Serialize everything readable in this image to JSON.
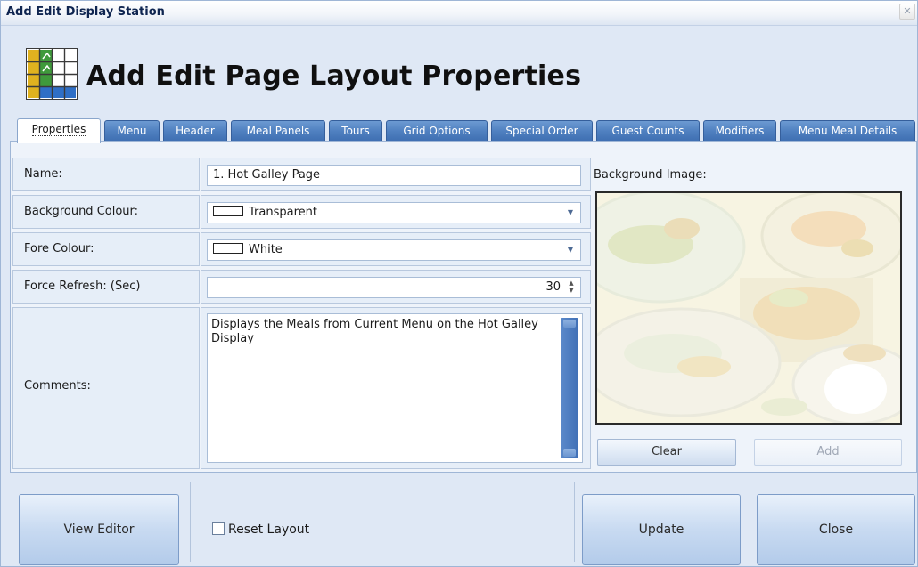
{
  "window": {
    "title": "Add Edit Display Station",
    "close_glyph": "✕"
  },
  "header": {
    "title": "Add Edit Page Layout Properties",
    "logo_icon": "grid-table-icon"
  },
  "tabs": [
    {
      "label": "Properties",
      "active": true
    },
    {
      "label": "Menu",
      "active": false
    },
    {
      "label": "Header",
      "active": false
    },
    {
      "label": "Meal Panels",
      "active": false
    },
    {
      "label": "Tours",
      "active": false
    },
    {
      "label": "Grid Options",
      "active": false
    },
    {
      "label": "Special Order",
      "active": false
    },
    {
      "label": "Guest Counts",
      "active": false
    },
    {
      "label": "Modifiers",
      "active": false
    },
    {
      "label": "Menu Meal Details",
      "active": false
    }
  ],
  "form": {
    "name": {
      "label": "Name:",
      "value": "1. Hot Galley Page"
    },
    "background_colour": {
      "label": "Background Colour:",
      "value": "Transparent"
    },
    "fore_colour": {
      "label": "Fore Colour:",
      "value": "White"
    },
    "force_refresh": {
      "label": "Force Refresh: (Sec)",
      "value": "30"
    },
    "comments": {
      "label": "Comments:",
      "value": "Displays the Meals from Current Menu on the Hot Galley Display"
    }
  },
  "background_image": {
    "label": "Background Image:",
    "clear_label": "Clear",
    "add_label": "Add"
  },
  "footer": {
    "view_editor_label": "View Editor",
    "reset_layout_label": "Reset Layout",
    "update_label": "Update",
    "close_label": "Close"
  },
  "colors": {
    "tab_blue": "#4f80c0",
    "window_bg": "#dfe8f5"
  }
}
